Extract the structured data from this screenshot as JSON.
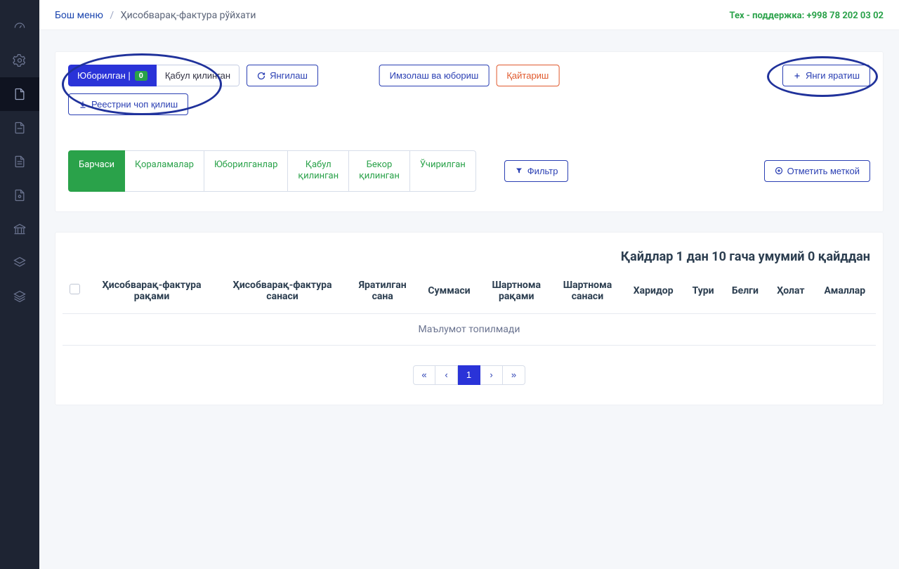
{
  "breadcrumb": {
    "home": "Бош меню",
    "current": "Ҳисобварақ-фактура рўйхати"
  },
  "support_label": "Тех - поддержка: +998 78 202 03 02",
  "sidebar": {
    "items": [
      {
        "icon": "dashboard"
      },
      {
        "icon": "gear"
      },
      {
        "icon": "document"
      },
      {
        "icon": "document2"
      },
      {
        "icon": "document3"
      },
      {
        "icon": "document4"
      },
      {
        "icon": "bank"
      },
      {
        "icon": "layers"
      },
      {
        "icon": "layers2"
      }
    ]
  },
  "toolbar": {
    "sent_label": "Юборилган |",
    "sent_count": "0",
    "received_label": "Қабул қилинган",
    "refresh_label": "Янгилаш",
    "sign_label": "Имзолаш ва юбориш",
    "return_label": "Қайтариш",
    "create_label": "Янги яратиш",
    "print_label": "Реестрни чоп қилиш"
  },
  "tabs": {
    "all": "Барчаси",
    "drafts": "Қораламалар",
    "sent": "Юборилганлар",
    "accepted": "Қабул\nқилинган",
    "rejected": "Бекор\nқилинган",
    "deleted": "Ўчирилган",
    "filter_label": "Фильтр",
    "mark_label": "Отметить меткой"
  },
  "records": {
    "summary": "Қайдлар 1 дан 10 гача умумий 0 қайддан",
    "columns": {
      "c1": "Ҳисобварақ-фактура\nрақами",
      "c2": "Ҳисобварақ-фактура\nсанаси",
      "c3": "Яратилган\nсана",
      "c4": "Суммаси",
      "c5": "Шартнома\nрақами",
      "c6": "Шартнома\nсанаси",
      "c7": "Харидор",
      "c8": "Тури",
      "c9": "Белги",
      "c10": "Ҳолат",
      "c11": "Амаллар"
    },
    "empty": "Маълумот топилмади"
  },
  "pagination": {
    "first": "«",
    "prev": "‹",
    "page1": "1",
    "next": "›",
    "last": "»"
  }
}
